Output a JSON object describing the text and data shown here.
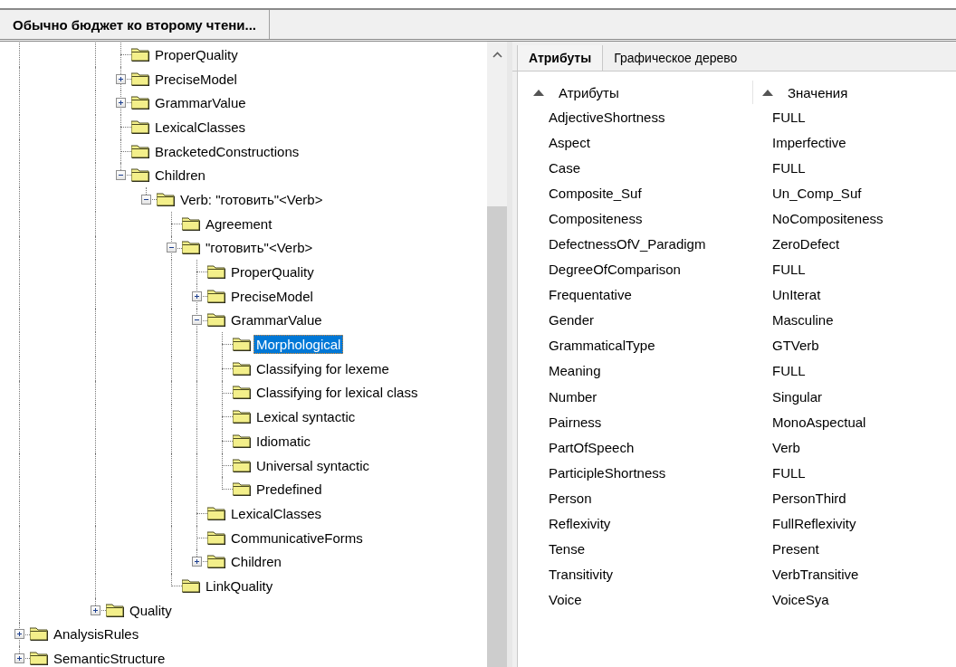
{
  "document_tabs": [
    {
      "label": "Обычно бюджет ко второму чтени...",
      "selected": true
    }
  ],
  "tree": {
    "items": [
      {
        "children": [
          {
            "children": [
              {
                "children": [
                  {
                    "children": [
                      {
                        "label": "ProperQuality",
                        "selected": false
                      },
                      {
                        "label": "PreciseModel",
                        "selected": false,
                        "expanded": false
                      },
                      {
                        "label": "GrammarValue",
                        "selected": false,
                        "expanded": false
                      },
                      {
                        "label": "LexicalClasses",
                        "selected": false
                      },
                      {
                        "label": "BracketedConstructions",
                        "selected": false
                      },
                      {
                        "label": "Children",
                        "selected": false,
                        "expanded": true,
                        "children": [
                          {
                            "label": "Verb: \"готовить\"<Verb>",
                            "selected": false,
                            "expanded": true,
                            "children": [
                              {
                                "label": "Agreement",
                                "selected": false
                              },
                              {
                                "label": "\"готовить\"<Verb>",
                                "selected": false,
                                "expanded": true,
                                "children": [
                                  {
                                    "label": "ProperQuality",
                                    "selected": false
                                  },
                                  {
                                    "label": "PreciseModel",
                                    "selected": false,
                                    "expanded": false
                                  },
                                  {
                                    "label": "GrammarValue",
                                    "selected": false,
                                    "expanded": true,
                                    "children": [
                                      {
                                        "label": "Morphological",
                                        "selected": true
                                      },
                                      {
                                        "label": "Classifying for lexeme",
                                        "selected": false
                                      },
                                      {
                                        "label": "Classifying for lexical class",
                                        "selected": false
                                      },
                                      {
                                        "label": "Lexical syntactic",
                                        "selected": false
                                      },
                                      {
                                        "label": "Idiomatic",
                                        "selected": false
                                      },
                                      {
                                        "label": "Universal syntactic",
                                        "selected": false
                                      },
                                      {
                                        "label": "Predefined",
                                        "selected": false
                                      }
                                    ]
                                  },
                                  {
                                    "label": "LexicalClasses",
                                    "selected": false
                                  },
                                  {
                                    "label": "CommunicativeForms",
                                    "selected": false
                                  },
                                  {
                                    "label": "Children",
                                    "selected": false,
                                    "expanded": false
                                  }
                                ]
                              },
                              {
                                "label": "LinkQuality",
                                "selected": false
                              }
                            ]
                          }
                        ]
                      }
                    ]
                  },
                  {
                    "label": "Quality",
                    "selected": false,
                    "expanded": false
                  }
                ]
              }
            ]
          }
        ]
      },
      {
        "label": "AnalysisRules",
        "selected": false,
        "expanded": false
      },
      {
        "label": "SemanticStructure",
        "selected": false,
        "expanded": false
      }
    ]
  },
  "attributes_panel": {
    "tabs": [
      {
        "label": "Атрибуты",
        "selected": true
      },
      {
        "label": "Графическое дерево",
        "selected": false
      }
    ],
    "columns": [
      "Атрибуты",
      "Значения"
    ],
    "rows": [
      {
        "attribute": "AdjectiveShortness",
        "value": "FULL"
      },
      {
        "attribute": "Aspect",
        "value": "Imperfective"
      },
      {
        "attribute": "Case",
        "value": "FULL"
      },
      {
        "attribute": "Composite_Suf",
        "value": "Un_Comp_Suf"
      },
      {
        "attribute": "Compositeness",
        "value": "NoCompositeness"
      },
      {
        "attribute": "DefectnessOfV_Paradigm",
        "value": "ZeroDefect"
      },
      {
        "attribute": "DegreeOfComparison",
        "value": "FULL"
      },
      {
        "attribute": "Frequentative",
        "value": "UnIterat"
      },
      {
        "attribute": "Gender",
        "value": "Masculine"
      },
      {
        "attribute": "GrammaticalType",
        "value": "GTVerb"
      },
      {
        "attribute": "Meaning",
        "value": "FULL"
      },
      {
        "attribute": "Number",
        "value": "Singular"
      },
      {
        "attribute": "Pairness",
        "value": "MonoAspectual"
      },
      {
        "attribute": "PartOfSpeech",
        "value": "Verb"
      },
      {
        "attribute": "ParticipleShortness",
        "value": "FULL"
      },
      {
        "attribute": "Person",
        "value": "PersonThird"
      },
      {
        "attribute": "Reflexivity",
        "value": "FullReflexivity"
      },
      {
        "attribute": "Tense",
        "value": "Present"
      },
      {
        "attribute": "Transitivity",
        "value": "VerbTransitive"
      },
      {
        "attribute": "Voice",
        "value": "VoiceSya"
      }
    ]
  }
}
